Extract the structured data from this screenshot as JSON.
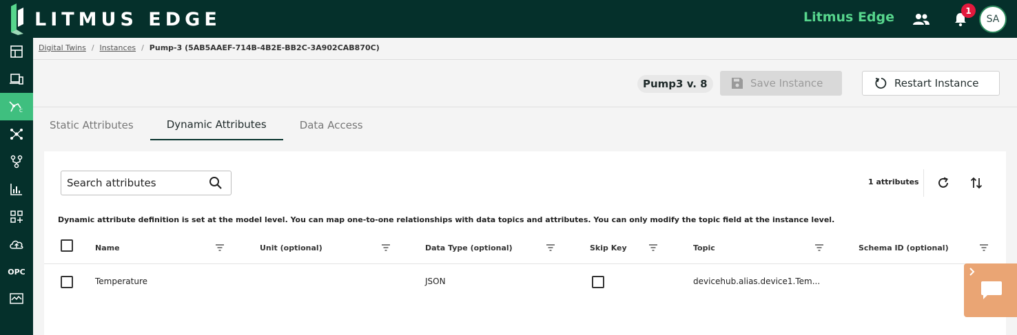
{
  "app": {
    "logo_text": "LITMUS EDGE",
    "brand_name": "Litmus Edge",
    "notification_count": "1",
    "user_initials": "SA"
  },
  "sidebar": {
    "items": [
      {
        "icon": "dashboard-icon"
      },
      {
        "icon": "devices-icon"
      },
      {
        "icon": "digital-twins-icon",
        "active": true
      },
      {
        "icon": "integration-icon"
      },
      {
        "icon": "flows-icon"
      },
      {
        "icon": "analytics-icon"
      },
      {
        "icon": "applications-icon"
      },
      {
        "icon": "cloud-icon"
      },
      {
        "icon": "opc-icon",
        "label": "OPC"
      },
      {
        "icon": "monitoring-icon"
      }
    ]
  },
  "breadcrumb": {
    "items": [
      "Digital Twins",
      "Instances"
    ],
    "separator": "/",
    "current": "Pump-3 (5AB5AAEF-714B-4B2E-BB2C-3A902CAB870C)"
  },
  "actions": {
    "version": "Pump3 v. 8",
    "save_label": "Save Instance",
    "restart_label": "Restart Instance"
  },
  "tabs": [
    {
      "label": "Static Attributes"
    },
    {
      "label": "Dynamic Attributes",
      "active": true
    },
    {
      "label": "Data Access"
    }
  ],
  "panel": {
    "search_placeholder": "Search attributes",
    "attr_count": "1 attributes",
    "note": "Dynamic attribute definition is set at the model level. You can map one-to-one relationships with data topics and attributes. You can only modify the topic field at the instance level."
  },
  "table": {
    "columns": [
      "Name",
      "Unit (optional)",
      "Data Type (optional)",
      "Skip Key",
      "Topic",
      "Schema ID (optional)"
    ],
    "rows": [
      {
        "name": "Temperature",
        "unit": "",
        "data_type": "JSON",
        "skip_key": false,
        "topic": "devicehub.alias.device1.Tem...",
        "schema_id": ""
      }
    ]
  },
  "colors": {
    "topbar": "#05302b",
    "brand_green": "#57d68d",
    "active_sidebar": "#3fbf7f",
    "badge_red": "#e3193d",
    "chat_widget": "#eaa574"
  }
}
